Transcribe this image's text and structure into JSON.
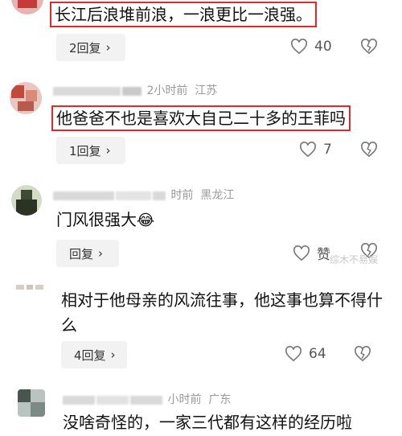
{
  "comments": [
    {
      "text": "长江后浪堆前浪，一浪更比一浪强。",
      "reply_label": "2回复",
      "likes": "40"
    },
    {
      "time": "2小时前",
      "location": "江苏",
      "text": "他爸爸不也是喜欢大自己二十多的王菲吗",
      "reply_label": "1回复",
      "likes": "7"
    },
    {
      "time": "时前",
      "location": "黑龙江",
      "text": "门风很强大",
      "emoji": "😂",
      "reply_label": "回复",
      "likes": "赞"
    },
    {
      "text": "相对于他母亲的风流往事，他这事也算不得什么",
      "reply_label": "4回复",
      "likes": "64"
    },
    {
      "time": "小时前",
      "location": "广东",
      "text": "没啥奇怪的，一家三代都有这样的经历啦"
    }
  ],
  "watermark": "综木不易娱",
  "icons": {
    "like": "heart-outline-icon",
    "dislike": "broken-heart-icon",
    "reply_chevron": "chevron-right-icon"
  },
  "colors": {
    "highlight_box": "#e02a2a",
    "reply_button_bg": "#f2f2f2",
    "meta_text": "#9a9a9a"
  }
}
